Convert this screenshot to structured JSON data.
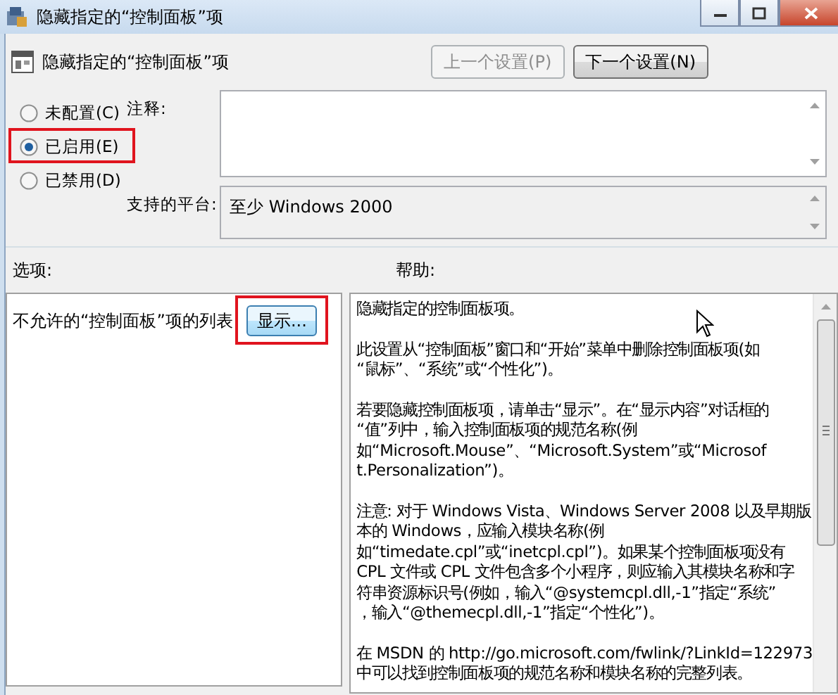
{
  "window": {
    "title": "隐藏指定的“控制面板”项"
  },
  "header": {
    "title": "隐藏指定的“控制面板”项",
    "buttons": [
      {
        "label": "上一个设置(P)",
        "disabled": true
      },
      {
        "label": "下一个设置(N)",
        "disabled": false
      }
    ]
  },
  "state_options": [
    {
      "label": "未配置(C)",
      "selected": false,
      "highlighted": false
    },
    {
      "label": "已启用(E)",
      "selected": true,
      "highlighted": true
    },
    {
      "label": "已禁用(D)",
      "selected": false,
      "highlighted": false
    }
  ],
  "comment": {
    "label": "注释:"
  },
  "platform": {
    "label": "支持的平台:",
    "value": "至少 Windows 2000"
  },
  "options": {
    "label": "选项:",
    "items": [
      {
        "label": "不允许的“控制面板”项的列表",
        "button": "显示...",
        "highlighted": true
      }
    ]
  },
  "help": {
    "label": "帮助:",
    "paragraphs": [
      [
        "隐藏指定的控制面板项。"
      ],
      [
        "此设置从“控制面板”窗口和“开始”菜单中删除控制面板项(如",
        "“鼠标”、“系统”或“个性化”)。"
      ],
      [
        "若要隐藏控制面板项，请单击“显示”。在“显示内容”对话框的",
        "“值”列中，输入控制面板项的规范名称(例",
        "如“Microsoft.Mouse”、“Microsoft.System”或“Microsof",
        "t.Personalization”)。"
      ],
      [
        "注意: 对于 Windows Vista、Windows Server 2008 以及早期版",
        "本的 Windows，应输入模块名称(例",
        "如“timedate.cpl”或“inetcpl.cpl”)。如果某个控制面板项没有",
        "CPL 文件或 CPL 文件包含多个小程序，则应输入其模块名称和字",
        "符串资源标识号(例如，输入“@systemcpl.dll,-1”指定“系统”",
        "，输入“@themecpl.dll,-1”指定“个性化”)。"
      ],
      [
        "在 MSDN 的 http://go.microsoft.com/fwlink/?LinkId=122973",
        "中可以找到控制面板项的规范名称和模块名称的完整列表。"
      ]
    ]
  }
}
